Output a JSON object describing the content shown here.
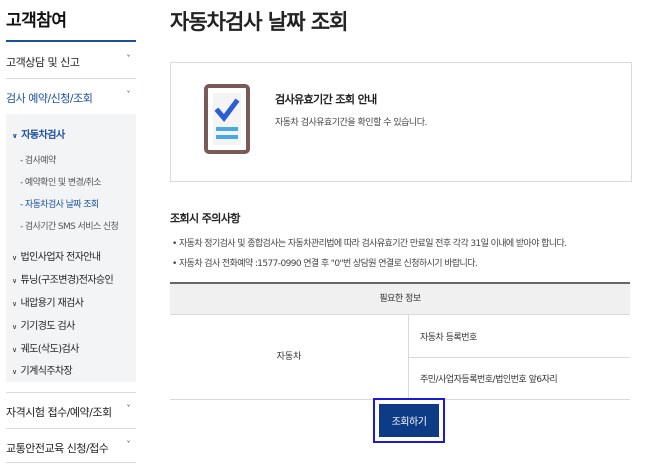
{
  "sidebar": {
    "title": "고객참여",
    "menu": [
      {
        "label": "고객상담 및 신고",
        "chevron": "˅"
      },
      {
        "label": "검사 예약/신청/조회",
        "chevron": "˅"
      }
    ],
    "sub_head": "자동차검사",
    "sub_head_arrow": "∨",
    "sub_items": [
      "- 검사예약",
      "- 예약확인 및 변경/취소",
      "- 자동차검사 날짜 조회",
      "- 검사기간 SMS 서비스 신청"
    ],
    "groups": [
      "법인사업자 전자안내",
      "튜닝(구조변경)전자승인",
      "내압용기 재검사",
      "기기경도 검사",
      "궤도(삭도)검사",
      "기계식주차장"
    ],
    "group_arrow": "∨",
    "bottom_menu": [
      {
        "label": "자격시험 접수/예약/조회",
        "chevron": "˅"
      },
      {
        "label": "교통안전교육 신청/접수",
        "chevron": "˅"
      }
    ]
  },
  "main": {
    "title": "자동차검사 날짜 조회",
    "info": {
      "title": "검사유효기간 조회 안내",
      "desc": "자동차 검사유효기간을 확인할 수 있습니다."
    },
    "notice": {
      "title": "조회시 주의사항",
      "lines": [
        "• 자동차 정기검사 및 종합검사는 자동차관리법에 따라 검사유효기간 만료일 전후 각각 31일 이내에 받아야 합니다.",
        "• 자동차 검사 전화예약 :1577-0990 연결 후 \"0\"번 상담원 연결로 신청하시기 바랍니다."
      ]
    },
    "table": {
      "header": "필요한 정보",
      "left": "자동차",
      "items": [
        "자동차 등록번호",
        "주민/사업자등록번호/법인번호 앞6자리"
      ]
    },
    "button_label": "조회하기",
    "bottom_cut": "~~~~~"
  },
  "colors": {
    "accent": "#1a4fa0",
    "button": "#0d3b85",
    "icon": "#7a5a56",
    "icon_check": "#2b5ed6",
    "icon_bar": "#4aa8e8"
  }
}
